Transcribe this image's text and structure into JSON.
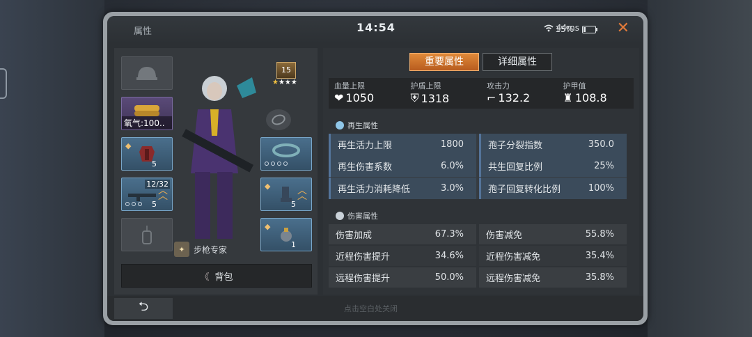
{
  "window": {
    "title": "属性",
    "time": "14:54",
    "ping": "44ms",
    "battery": "15%",
    "close": "✕"
  },
  "equipment": {
    "oxygen_label": "氧气:100..",
    "armor_level": "5",
    "weapon_ammo": "12/32",
    "weapon_level": "5",
    "boots_level": "5",
    "item_count": "1"
  },
  "character": {
    "level": "15",
    "stars": "★★★",
    "star_lit": "★",
    "specialist": "步枪专家"
  },
  "bag_button": {
    "arrow": "《",
    "label": "背包"
  },
  "tabs": [
    {
      "label": "重要属性",
      "active": true
    },
    {
      "label": "详细属性",
      "active": false
    }
  ],
  "main_stats": [
    {
      "label": "血量上限",
      "icon": "heart-icon",
      "value": "1050"
    },
    {
      "label": "护盾上限",
      "icon": "shield-icon",
      "value": "1318"
    },
    {
      "label": "攻击力",
      "icon": "gun-icon",
      "value": "132.2"
    },
    {
      "label": "护甲值",
      "icon": "armor-icon",
      "value": "108.8"
    }
  ],
  "regen": {
    "title": "再生属性",
    "rows": [
      {
        "left_label": "再生活力上限",
        "left_value": "1800",
        "right_label": "孢子分裂指数",
        "right_value": "350.0"
      },
      {
        "left_label": "再生伤害系数",
        "left_value": "6.0%",
        "right_label": "共生回复比例",
        "right_value": "25%"
      },
      {
        "left_label": "再生活力消耗降低",
        "left_value": "3.0%",
        "right_label": "孢子回复转化比例",
        "right_value": "100%"
      }
    ]
  },
  "damage": {
    "title": "伤害属性",
    "rows": [
      {
        "left_label": "伤害加成",
        "left_value": "67.3%",
        "right_label": "伤害减免",
        "right_value": "55.8%"
      },
      {
        "left_label": "近程伤害提升",
        "left_value": "34.6%",
        "right_label": "近程伤害减免",
        "right_value": "35.4%"
      },
      {
        "left_label": "远程伤害提升",
        "left_value": "50.0%",
        "right_label": "远程伤害减免",
        "right_value": "35.8%"
      }
    ]
  },
  "footer": {
    "back": "⮌",
    "hint": "点击空白处关闭"
  },
  "colors": {
    "accent": "#e08a3a",
    "regen_cell": "#3b4b5b",
    "purple_slot": "#5a4a78",
    "blue_slot": "#4a6f8c"
  }
}
